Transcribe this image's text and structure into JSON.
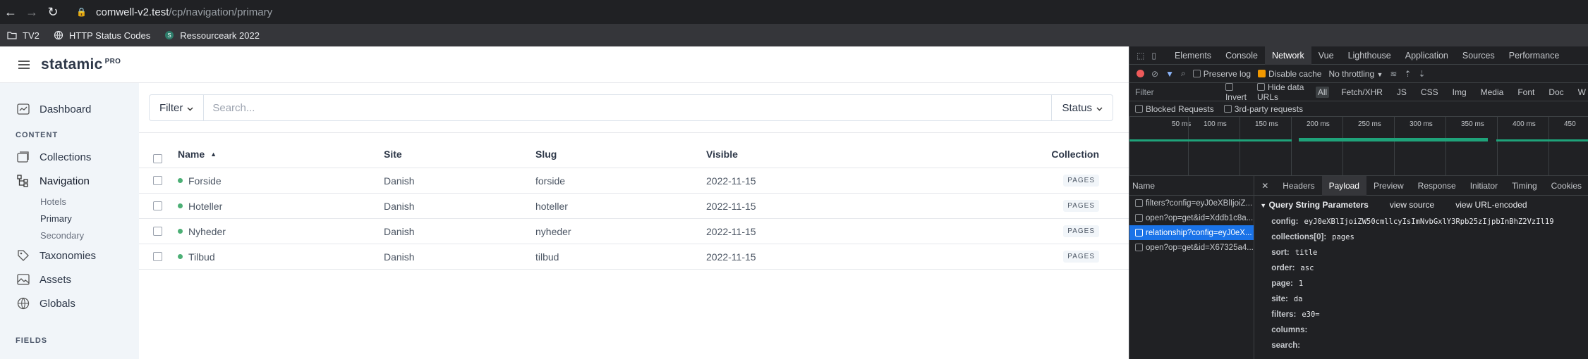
{
  "browser": {
    "url_host": "comwell-v2.test",
    "url_path": "/cp/navigation/primary",
    "bookmarks": [
      {
        "label": "TV2"
      },
      {
        "label": "HTTP Status Codes"
      },
      {
        "label": "Ressourceark 2022"
      }
    ]
  },
  "app": {
    "logo": "statamic",
    "logo_badge": "PRO"
  },
  "sidebar": {
    "dashboard": "Dashboard",
    "content_section": "CONTENT",
    "collections": "Collections",
    "navigation": "Navigation",
    "nav_children": [
      "Hotels",
      "Primary",
      "Secondary"
    ],
    "taxonomies": "Taxonomies",
    "assets": "Assets",
    "globals": "Globals",
    "fields_section": "FIELDS"
  },
  "filterbar": {
    "filter_label": "Filter",
    "search_placeholder": "Search...",
    "status_label": "Status"
  },
  "table": {
    "headers": {
      "name": "Name",
      "site": "Site",
      "slug": "Slug",
      "visible": "Visible",
      "collection": "Collection"
    },
    "rows": [
      {
        "name": "Forside",
        "site": "Danish",
        "slug": "forside",
        "visible": "2022-11-15",
        "collection": "PAGES"
      },
      {
        "name": "Hoteller",
        "site": "Danish",
        "slug": "hoteller",
        "visible": "2022-11-15",
        "collection": "PAGES"
      },
      {
        "name": "Nyheder",
        "site": "Danish",
        "slug": "nyheder",
        "visible": "2022-11-15",
        "collection": "PAGES"
      },
      {
        "name": "Tilbud",
        "site": "Danish",
        "slug": "tilbud",
        "visible": "2022-11-15",
        "collection": "PAGES"
      }
    ]
  },
  "devtools": {
    "tabs": [
      "Elements",
      "Console",
      "Network",
      "Vue",
      "Lighthouse",
      "Application",
      "Sources",
      "Performance"
    ],
    "active_tab": "Network",
    "preserve_log": "Preserve log",
    "disable_cache": "Disable cache",
    "throttling": "No throttling",
    "filter_placeholder": "Filter",
    "invert": "Invert",
    "hide_data_urls": "Hide data URLs",
    "types": [
      "All",
      "Fetch/XHR",
      "JS",
      "CSS",
      "Img",
      "Media",
      "Font",
      "Doc",
      "W"
    ],
    "blocked_requests": "Blocked Requests",
    "third_party": "3rd-party requests",
    "ticks": [
      "50 ms",
      "100 ms",
      "150 ms",
      "200 ms",
      "250 ms",
      "300 ms",
      "350 ms",
      "400 ms",
      "450"
    ],
    "name_header": "Name",
    "requests": [
      "filters?config=eyJ0eXBlIjoiZ...",
      "open?op=get&id=Xddb1c8a...",
      "relationship?config=eyJ0eX...",
      "open?op=get&id=X67325a4..."
    ],
    "detail_tabs": [
      "Headers",
      "Payload",
      "Preview",
      "Response",
      "Initiator",
      "Timing",
      "Cookies"
    ],
    "active_detail_tab": "Payload",
    "qs_title": "Query String Parameters",
    "view_source": "view source",
    "view_url_encoded": "view URL-encoded",
    "params": [
      {
        "k": "config:",
        "v": "eyJ0eXBlIjoiZW50cmllcyIsImNvbGxlY3Rpb25zIjpbInBhZ2VzIl19"
      },
      {
        "k": "collections[0]:",
        "v": "pages"
      },
      {
        "k": "sort:",
        "v": "title"
      },
      {
        "k": "order:",
        "v": "asc"
      },
      {
        "k": "page:",
        "v": "1"
      },
      {
        "k": "site:",
        "v": "da"
      },
      {
        "k": "filters:",
        "v": "e30="
      },
      {
        "k": "columns:",
        "v": ""
      },
      {
        "k": "search:",
        "v": ""
      }
    ]
  }
}
